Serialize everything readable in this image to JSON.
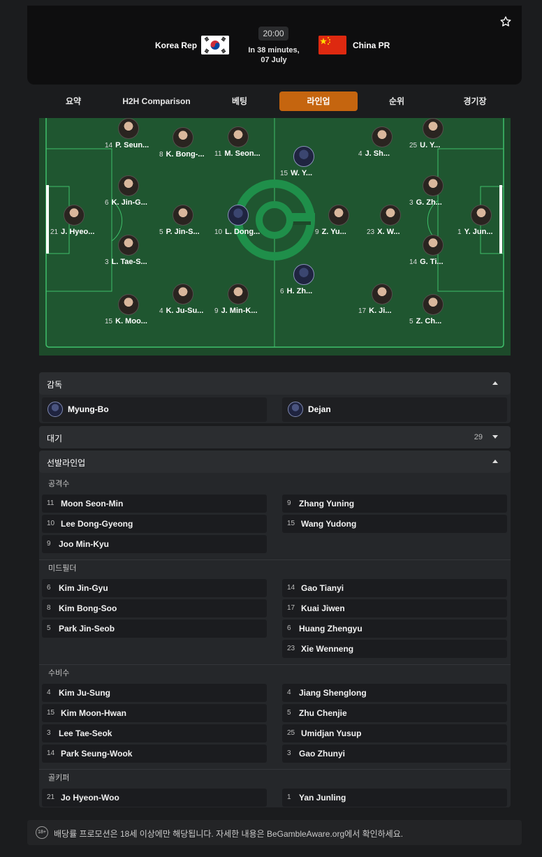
{
  "match": {
    "home_team": "Korea Rep",
    "away_team": "China PR",
    "kickoff_time": "20:00",
    "countdown_line1": "In 38 minutes,",
    "countdown_line2": "07 July",
    "icons": {
      "favorite": "star-icon",
      "home_flag": "korea-flag-icon",
      "away_flag": "china-flag-icon"
    }
  },
  "tabs": [
    {
      "label": "요약",
      "active": false
    },
    {
      "label": "H2H Comparison",
      "active": false
    },
    {
      "label": "베팅",
      "active": false
    },
    {
      "label": "라인업",
      "active": true
    },
    {
      "label": "순위",
      "active": false
    },
    {
      "label": "경기장",
      "active": false
    }
  ],
  "pitch": {
    "home": [
      {
        "num": "14",
        "name": "P. Seun..."
      },
      {
        "num": "8",
        "name": "K. Bong-..."
      },
      {
        "num": "11",
        "name": "M. Seon..."
      },
      {
        "num": "6",
        "name": "K. Jin-G..."
      },
      {
        "num": "21",
        "name": "J. Hyeo..."
      },
      {
        "num": "5",
        "name": "P. Jin-S..."
      },
      {
        "num": "10",
        "name": "L. Dong..."
      },
      {
        "num": "3",
        "name": "L. Tae-S..."
      },
      {
        "num": "4",
        "name": "K. Ju-Su..."
      },
      {
        "num": "9",
        "name": "J. Min-K..."
      },
      {
        "num": "15",
        "name": "K. Moo..."
      }
    ],
    "away": [
      {
        "num": "15",
        "name": "W. Y..."
      },
      {
        "num": "4",
        "name": "J. Sh..."
      },
      {
        "num": "25",
        "name": "U. Y..."
      },
      {
        "num": "3",
        "name": "G. Zh..."
      },
      {
        "num": "9",
        "name": "Z. Yu..."
      },
      {
        "num": "23",
        "name": "X. W..."
      },
      {
        "num": "1",
        "name": "Y. Jun..."
      },
      {
        "num": "14",
        "name": "G. Ti..."
      },
      {
        "num": "6",
        "name": "H. Zh..."
      },
      {
        "num": "17",
        "name": "K. Ji..."
      },
      {
        "num": "5",
        "name": "Z. Ch..."
      }
    ]
  },
  "coaches": {
    "title": "감독",
    "home": "Myung-Bo",
    "away": "Dejan"
  },
  "substitutes": {
    "title": "대기",
    "count": "29"
  },
  "lineup": {
    "title": "선발라인업",
    "groups": {
      "forwards": {
        "title": "공격수",
        "home": [
          {
            "num": "11",
            "name": "Moon Seon-Min"
          },
          {
            "num": "10",
            "name": "Lee Dong-Gyeong"
          },
          {
            "num": "9",
            "name": "Joo Min-Kyu"
          }
        ],
        "away": [
          {
            "num": "9",
            "name": "Zhang Yuning"
          },
          {
            "num": "15",
            "name": "Wang Yudong"
          }
        ]
      },
      "midfielders": {
        "title": "미드필더",
        "home": [
          {
            "num": "6",
            "name": "Kim Jin-Gyu"
          },
          {
            "num": "8",
            "name": "Kim Bong-Soo"
          },
          {
            "num": "5",
            "name": "Park Jin-Seob"
          }
        ],
        "away": [
          {
            "num": "14",
            "name": "Gao Tianyi"
          },
          {
            "num": "17",
            "name": "Kuai Jiwen"
          },
          {
            "num": "6",
            "name": "Huang Zhengyu"
          },
          {
            "num": "23",
            "name": "Xie Wenneng"
          }
        ]
      },
      "defenders": {
        "title": "수비수",
        "home": [
          {
            "num": "4",
            "name": "Kim Ju-Sung"
          },
          {
            "num": "15",
            "name": "Kim Moon-Hwan"
          },
          {
            "num": "3",
            "name": "Lee Tae-Seok"
          },
          {
            "num": "14",
            "name": "Park Seung-Wook"
          }
        ],
        "away": [
          {
            "num": "4",
            "name": "Jiang Shenglong"
          },
          {
            "num": "5",
            "name": "Zhu Chenjie"
          },
          {
            "num": "25",
            "name": "Umidjan Yusup"
          },
          {
            "num": "3",
            "name": "Gao Zhunyi"
          }
        ]
      },
      "goalkeepers": {
        "title": "골키퍼",
        "home": [
          {
            "num": "21",
            "name": "Jo Hyeon-Woo"
          }
        ],
        "away": [
          {
            "num": "1",
            "name": "Yan Junling"
          }
        ]
      }
    }
  },
  "footer": {
    "badge": "18+",
    "text": "배당률 프로모션은 18세 이상에만 해당됩니다. 자세한 내용은 BeGambleAware.org에서 확인하세요."
  },
  "colors": {
    "accent": "#c5650f",
    "pitch": "#1d4a2a",
    "pitch_line": "#3fbf6a"
  }
}
